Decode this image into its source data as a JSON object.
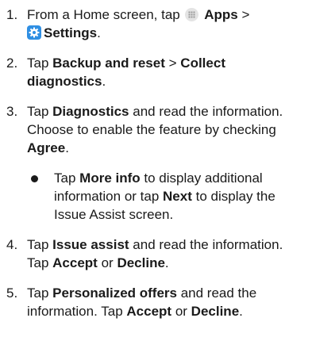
{
  "steps": [
    {
      "num": "1.",
      "t1": "From a Home screen, tap",
      "apps_icon": "apps-grid-icon",
      "apps": "Apps",
      "sep": ">",
      "settings_icon": "settings-gear-icon",
      "settings": "Settings",
      "end": "."
    },
    {
      "num": "2.",
      "t1": "Tap",
      "b1": "Backup and reset",
      "sep": ">",
      "b2": "Collect diagnostics",
      "end": "."
    },
    {
      "num": "3.",
      "t1": "Tap",
      "b1": "Diagnostics",
      "t2": "and read the information. Choose to enable the feature by checking",
      "b2": "Agree",
      "end": "."
    },
    {
      "num": "4.",
      "t1": "Tap",
      "b1": "Issue assist",
      "t2": "and read the information. Tap",
      "b2": "Accept",
      "t3": "or",
      "b3": "Decline",
      "end": "."
    },
    {
      "num": "5.",
      "t1": "Tap",
      "b1": "Personalized offers",
      "t2": "and read the information. Tap",
      "b2": "Accept",
      "t3": "or",
      "b3": "Decline",
      "end": "."
    }
  ],
  "sub": {
    "t1": "Tap",
    "b1": "More info",
    "t2": "to display additional information or tap",
    "b2": "Next",
    "t3": "to display the Issue Assist screen."
  }
}
